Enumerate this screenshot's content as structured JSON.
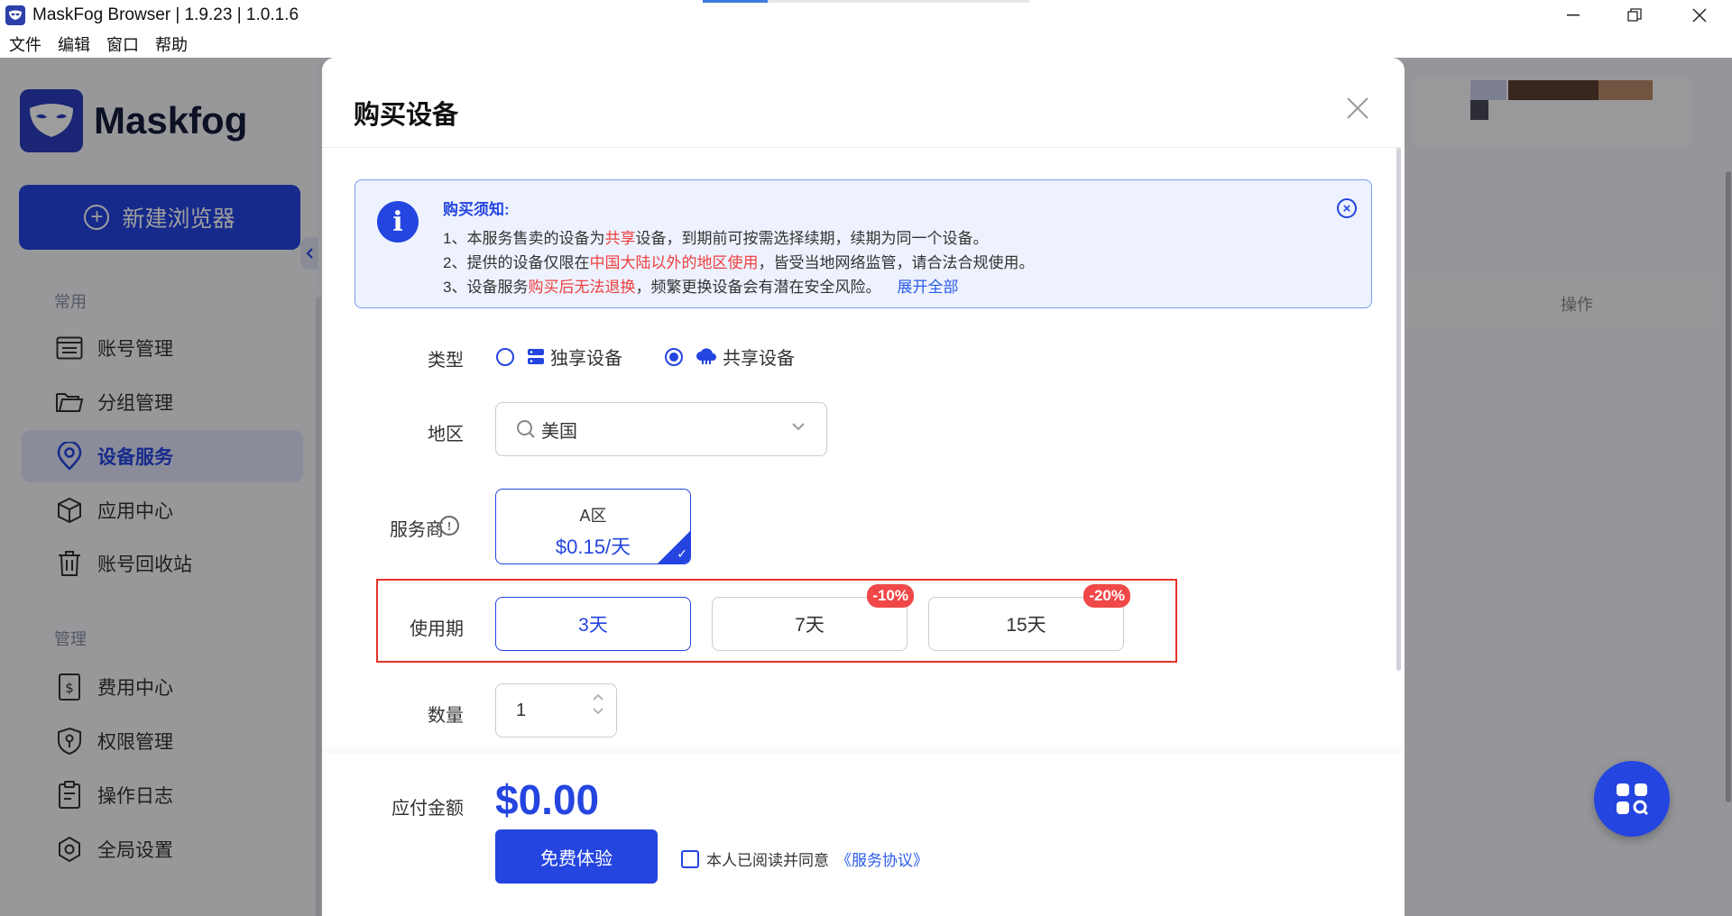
{
  "window": {
    "title": "MaskFog Browser | 1.9.23 | 1.0.1.6"
  },
  "menu": [
    "文件",
    "编辑",
    "窗口",
    "帮助"
  ],
  "sidebar": {
    "logo_text": "Maskfog",
    "new_button": "新建浏览器",
    "section_common": "常用",
    "common_items": [
      {
        "label": "账号管理",
        "icon": "account-list-icon"
      },
      {
        "label": "分组管理",
        "icon": "folder-icon"
      },
      {
        "label": "设备服务",
        "icon": "location-pin-icon",
        "active": true
      },
      {
        "label": "应用中心",
        "icon": "cube-icon"
      },
      {
        "label": "账号回收站",
        "icon": "trash-icon"
      }
    ],
    "section_manage": "管理",
    "manage_items": [
      {
        "label": "费用中心",
        "icon": "bill-icon"
      },
      {
        "label": "权限管理",
        "icon": "key-shield-icon"
      },
      {
        "label": "操作日志",
        "icon": "clipboard-icon"
      },
      {
        "label": "全局设置",
        "icon": "settings-icon"
      }
    ]
  },
  "background": {
    "column_op": "操作"
  },
  "modal": {
    "title": "购买设备",
    "notice": {
      "title": "购买须知:",
      "line1": {
        "a": "1、本服务售卖的设备为",
        "red": "共享",
        "b": "设备，到期前可按需选择续期，续期为同一个设备。"
      },
      "line2": {
        "a": "2、提供的设备仅限在",
        "red": "中国大陆以外的地区使用",
        "b": "，皆受当地网络监管，请合法合规使用。"
      },
      "line3": {
        "a": "3、设备服务",
        "red": "购买后无法退换",
        "b": "，频繁更换设备会有潜在安全风险。",
        "link": "展开全部"
      }
    },
    "type": {
      "label": "类型",
      "options": [
        {
          "label": "独享设备",
          "selected": false
        },
        {
          "label": "共享设备",
          "selected": true
        }
      ]
    },
    "region": {
      "label": "地区",
      "value": "美国"
    },
    "provider": {
      "label": "服务商",
      "name": "A区",
      "price": "$0.15/天"
    },
    "period": {
      "label": "使用期",
      "options": [
        {
          "label": "3天",
          "badge": "",
          "selected": true
        },
        {
          "label": "7天",
          "badge": "-10%",
          "selected": false
        },
        {
          "label": "15天",
          "badge": "-20%",
          "selected": false
        }
      ]
    },
    "quantity": {
      "label": "数量",
      "value": "1"
    },
    "payment": {
      "label": "应付金额",
      "amount": "$0.00"
    },
    "trial_button": "免费体验",
    "agree": {
      "text": "本人已阅读并同意",
      "link": "《服务协议》"
    }
  },
  "colors": {
    "accent": "#2445e0",
    "danger": "#f04848",
    "highlight_border": "#e8332b"
  }
}
